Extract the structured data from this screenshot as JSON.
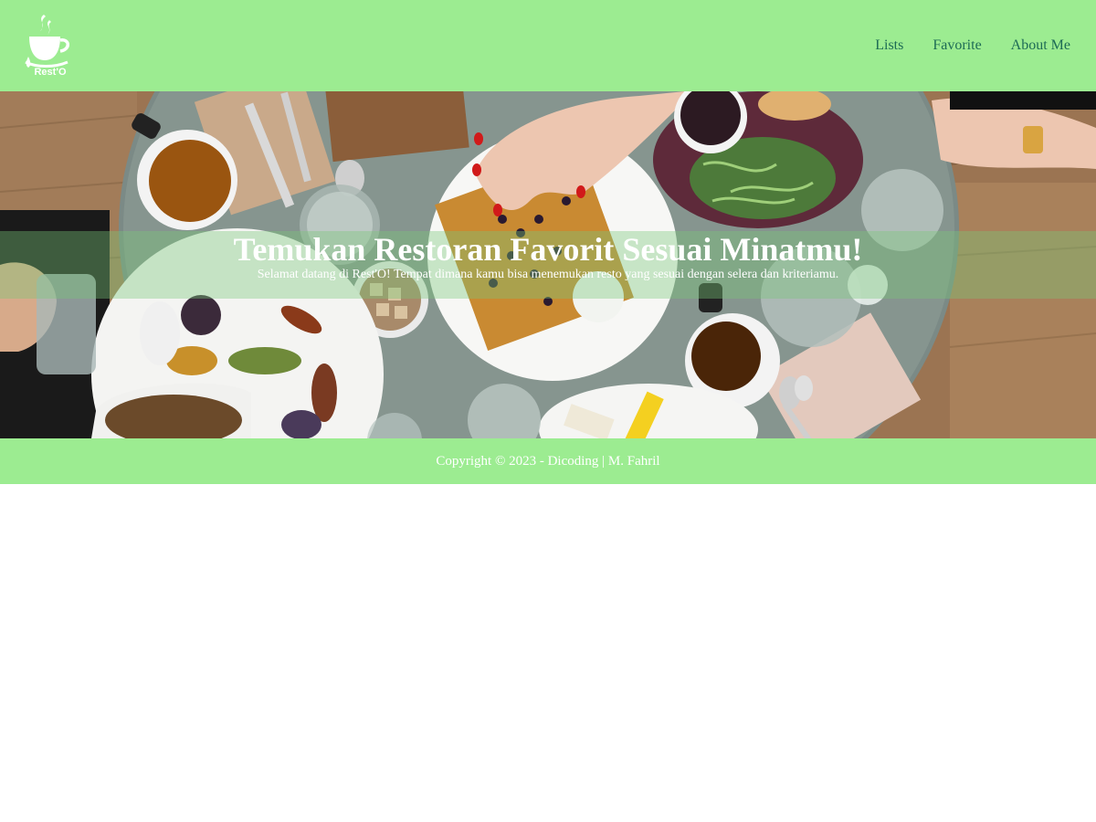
{
  "colors": {
    "navbar_bg": "#9cec91",
    "footer_bg": "#9cec91",
    "nav_link": "#1d6b55",
    "hero_text": "#ffffff"
  },
  "header": {
    "logo": {
      "icon": "coffee-cup-logo-icon",
      "text": "Rest'O"
    },
    "nav": [
      {
        "label": "Lists"
      },
      {
        "label": "Favorite"
      },
      {
        "label": "About Me"
      }
    ]
  },
  "hero": {
    "title": "Temukan Restoran Favorit Sesuai Minatmu!",
    "subtitle": "Selamat datang di Rest'O! Tempat dimana kamu bisa menemukan resto yang sesuai dengan selera dan kriteriamu."
  },
  "footer": {
    "copyright": "Copyright © 2023 - Dicoding | M. Fahril"
  }
}
